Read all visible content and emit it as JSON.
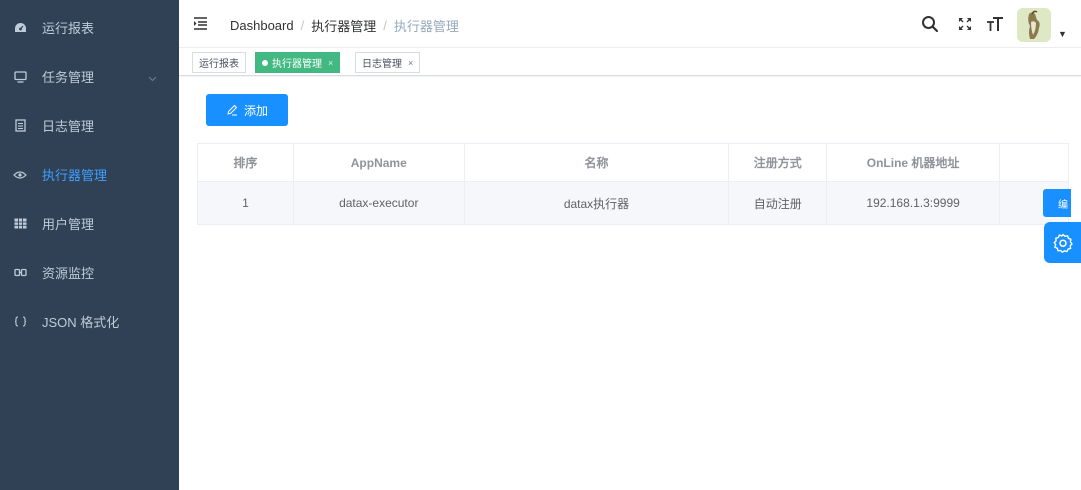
{
  "sidebar": {
    "items": [
      {
        "label": "运行报表",
        "icon": "dashboard-icon"
      },
      {
        "label": "任务管理",
        "icon": "monitor-icon"
      },
      {
        "label": "日志管理",
        "icon": "document-icon"
      },
      {
        "label": "执行器管理",
        "icon": "eye-icon"
      },
      {
        "label": "用户管理",
        "icon": "table-icon"
      },
      {
        "label": "资源监控",
        "icon": "monitor-glasses-icon"
      },
      {
        "label": "JSON 格式化",
        "icon": "braces-icon"
      }
    ],
    "active_color": "#409eff"
  },
  "breadcrumb": {
    "items": [
      "Dashboard",
      "执行器管理",
      "执行器管理"
    ],
    "separator": "/"
  },
  "tags": [
    {
      "label": "运行报表",
      "active": false
    },
    {
      "label": "执行器管理",
      "active": true,
      "close": "×"
    },
    {
      "label": "日志管理",
      "active": false,
      "close": "×"
    }
  ],
  "main": {
    "add_label": "添加",
    "table": {
      "headers": [
        "排序",
        "AppName",
        "名称",
        "注册方式",
        "OnLine 机器地址",
        ""
      ],
      "rows": [
        [
          "1",
          "datax-executor",
          "datax执行器",
          "自动注册",
          "192.168.1.3:9999",
          ""
        ]
      ]
    },
    "edit_label": "编"
  },
  "colors": {
    "sidebar_bg": "#304156",
    "primary": "#1890ff",
    "tag_active": "#42b983"
  }
}
